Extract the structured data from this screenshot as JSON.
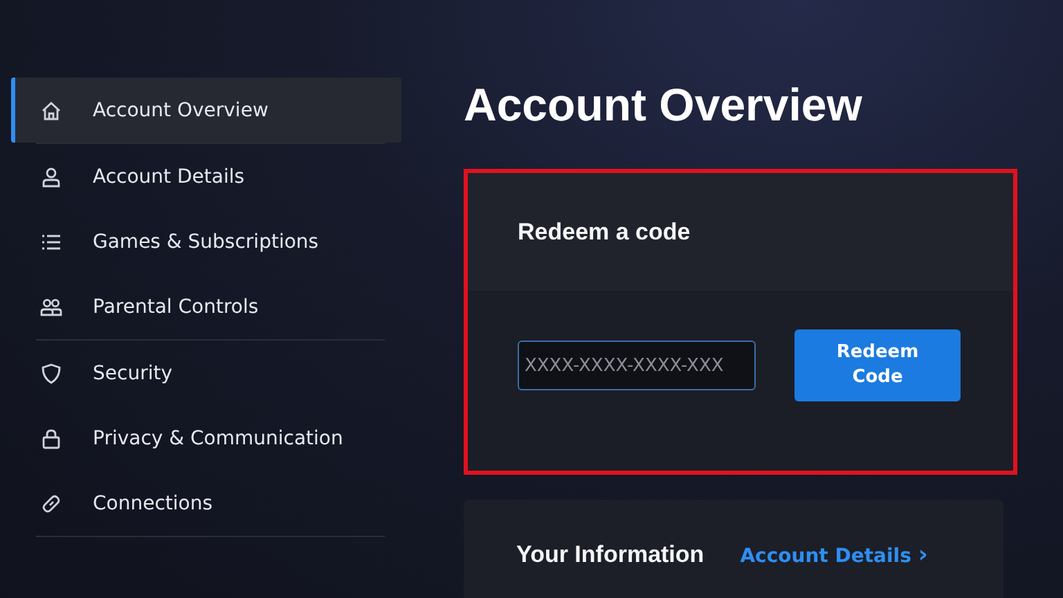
{
  "sidebar": {
    "groups": [
      {
        "items": [
          {
            "label": "Account Overview",
            "kind": "home",
            "selected": true
          }
        ]
      },
      {
        "items": [
          {
            "label": "Account Details",
            "kind": "person",
            "selected": false
          },
          {
            "label": "Games & Subscriptions",
            "kind": "list",
            "selected": false
          },
          {
            "label": "Parental Controls",
            "kind": "people",
            "selected": false
          }
        ]
      },
      {
        "items": [
          {
            "label": "Security",
            "kind": "shield",
            "selected": false
          },
          {
            "label": "Privacy & Communication",
            "kind": "lock",
            "selected": false
          },
          {
            "label": "Connections",
            "kind": "link",
            "selected": false
          }
        ]
      }
    ]
  },
  "page_title": "Account Overview",
  "redeem_card": {
    "title": "Redeem a code",
    "highlighted": true,
    "code_field": {
      "placeholder": "XXXX-XXXX-XXXX-XXX"
    },
    "button": "Redeem Code"
  },
  "info_card": {
    "title": "Your Information",
    "link": "Account Details",
    "link_icon": "›"
  }
}
